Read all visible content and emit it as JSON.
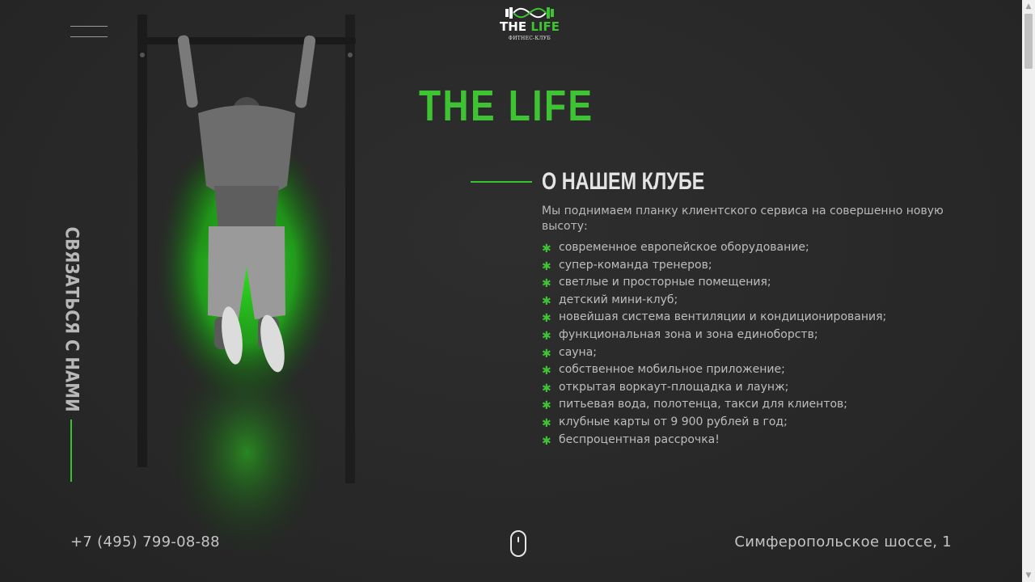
{
  "header": {
    "logo": {
      "word_1": "THE",
      "word_2": "LIFE",
      "subtitle": "ФИТНЕС-КЛУБ",
      "icon": "barbell-icon"
    },
    "menu_icon": "hamburger-menu-icon"
  },
  "side": {
    "contact_label": "Связаться с нами"
  },
  "main": {
    "title": "THE LIFE",
    "section_title": "О НАШЕМ КЛУБЕ",
    "intro": "Мы поднимаем планку клиентского сервиса на совершенно новую высоту:",
    "bullet_symbol": "✱",
    "features": [
      "современное европейское оборудование;",
      "супер-команда тренеров;",
      "светлые и просторные помещения;",
      "детский мини-клуб;",
      "новейшая система вентиляции и кондиционирования;",
      "функциональная зона и зона единоборств;",
      "сауна;",
      "собственное мобильное приложение;",
      "открытая воркаут-площадка и лаунж;",
      "питьевая вода, полотенца, такси для клиентов;",
      "клубные карты от 9 900 рублей в год;",
      "беспроцентная рассрочка!"
    ]
  },
  "footer": {
    "phone": "+7 (495) 799-08-88",
    "scroll_icon": "mouse-scroll-icon",
    "address": "Симферопольское шоссе, 1"
  },
  "colors": {
    "accent": "#3ec433",
    "background": "#2a2a2a",
    "text": "#bdbdbd"
  }
}
